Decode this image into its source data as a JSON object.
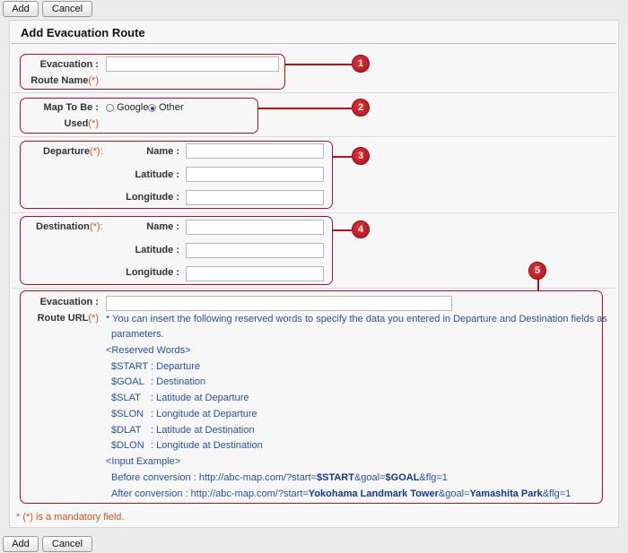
{
  "toolbar": {
    "add_label": "Add",
    "cancel_label": "Cancel"
  },
  "form": {
    "title": "Add Evacuation Route",
    "route_name": {
      "label_line1": "Evacuation",
      "label_line2": "Route Name",
      "required": "(*)",
      "value": ""
    },
    "map": {
      "label_line1": "Map To Be",
      "label_line2": "Used",
      "required": "(*)",
      "options": [
        "Google",
        "Other"
      ],
      "selected": "Other"
    },
    "departure": {
      "label": "Departure",
      "required": "(*)",
      "colon": ":",
      "name_label": "Name",
      "latitude_label": "Latitude",
      "longitude_label": "Longitude",
      "name_value": "",
      "latitude_value": "",
      "longitude_value": ""
    },
    "destination": {
      "label": "Destination",
      "required": "(*)",
      "colon": ":",
      "name_label": "Name",
      "latitude_label": "Latitude",
      "longitude_label": "Longitude",
      "name_value": "",
      "latitude_value": "",
      "longitude_value": ""
    },
    "route_url": {
      "label_line1": "Evacuation",
      "label_line2": "Route URL",
      "required": "(*)",
      "value": "",
      "help_line1": "* You can insert the following reserved words to specify the data you entered in Departure and Destination fields as",
      "help_line2": "parameters.",
      "reserved_header": "<Reserved Words>",
      "reserved": [
        {
          "word": "$START",
          "desc": "Departure"
        },
        {
          "word": "$GOAL",
          "desc": "Destination"
        },
        {
          "word": "$SLAT",
          "desc": "Latitude at Departure"
        },
        {
          "word": "$SLON",
          "desc": "Longitude at Departure"
        },
        {
          "word": "$DLAT",
          "desc": "Latitude at Destination"
        },
        {
          "word": "$DLON",
          "desc": "Longitude at Destination"
        }
      ],
      "example_header": "<Input Example>",
      "before": {
        "label": "Before conversion",
        "p1": "http://abc-map.com/?start=",
        "b1": "$START",
        "p2": "&goal=",
        "b2": "$GOAL",
        "p3": "&flg=1"
      },
      "after": {
        "label": "After conversion",
        "p1": "http://abc-map.com/?start=",
        "b1": "Yokohama Landmark Tower",
        "p2": "&goal=",
        "b2": "Yamashita Park",
        "p3": "&flg=1"
      }
    },
    "footnote": "* (*) is a mandatory field."
  },
  "callouts": [
    "1",
    "2",
    "3",
    "4",
    "5"
  ],
  "colors": {
    "accent": "#b5121b",
    "required": "#d0541c",
    "help_text": "#2a4fa6"
  }
}
